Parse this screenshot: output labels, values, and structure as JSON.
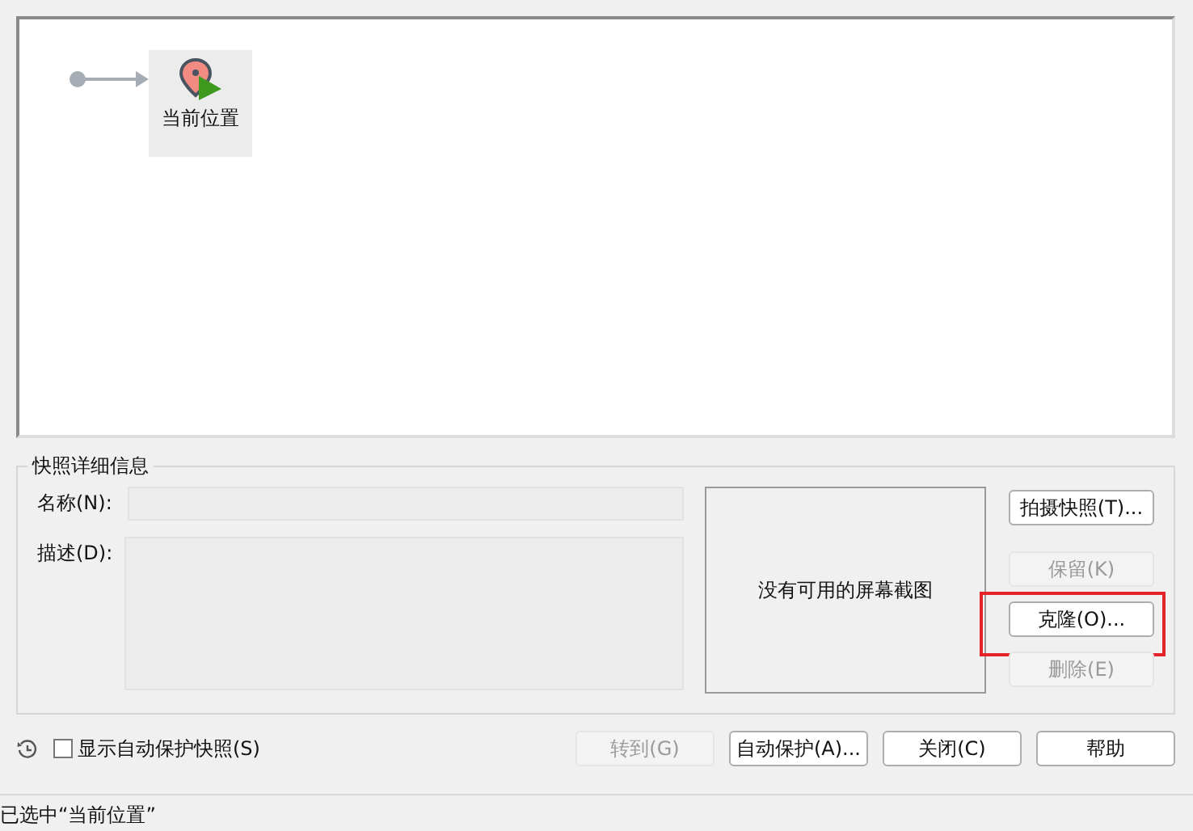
{
  "tree": {
    "nodes": [
      {
        "label": "当前位置",
        "selected": true
      }
    ]
  },
  "details": {
    "title": "快照详细信息",
    "name_label": "名称(N):",
    "description_label": "描述(D):",
    "screenshot_text": "没有可用的屏幕截图",
    "buttons": [
      {
        "label": "拍摄快照(T)...",
        "disabled": false,
        "highlighted": false
      },
      {
        "label": "保留(K)",
        "disabled": true,
        "highlighted": false
      },
      {
        "label": "克隆(O)...",
        "disabled": false,
        "highlighted": true
      },
      {
        "label": "删除(E)",
        "disabled": true,
        "highlighted": false
      }
    ]
  },
  "auto_protect": {
    "label": "显示自动保护快照(S)",
    "checked": false
  },
  "footer_buttons": [
    {
      "label": "转到(G)",
      "disabled": true
    },
    {
      "label": "自动保护(A)...",
      "disabled": false
    },
    {
      "label": "关闭(C)",
      "disabled": false
    },
    {
      "label": "帮助",
      "disabled": false
    }
  ],
  "status_bar": "已选中“当前位置”"
}
